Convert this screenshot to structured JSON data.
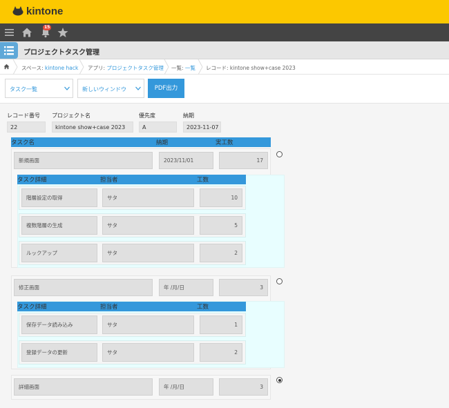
{
  "brand": {
    "name": "kintone"
  },
  "globalbar": {
    "notification_count": "15"
  },
  "app": {
    "title": "プロジェクトタスク管理"
  },
  "breadcrumb": {
    "space_prefix": "スペース: ",
    "space_name": "kintone hack",
    "app_prefix": "アプリ: ",
    "app_name": "プロジェクトタスク管理",
    "list_prefix": "一覧: ",
    "list_name": "一覧",
    "record": "レコード: kintone show+case 2023"
  },
  "toolbar": {
    "view_select": "タスク一覧",
    "window_select": "新しいウィンドウ",
    "pdf_button": "PDF出力"
  },
  "fields": {
    "record_no": {
      "label": "レコード番号",
      "value": "22"
    },
    "project_name": {
      "label": "プロジェクト名",
      "value": "kintone show+case 2023"
    },
    "priority": {
      "label": "優先度",
      "value": "A"
    },
    "deadline": {
      "label": "納期",
      "value": "2023-11-07"
    }
  },
  "task_table": {
    "headers": {
      "name": "タスク名",
      "deadline": "納期",
      "hours": "実工数"
    },
    "rows": [
      {
        "name": "新規画面",
        "deadline": "2023/11/01",
        "hours": "17",
        "detail_headers": {
          "detail": "タスク詳細",
          "assignee": "担当者",
          "hours": "工数"
        },
        "details": [
          {
            "detail": "階層設定の取得",
            "assignee": "サタ",
            "hours": "10"
          },
          {
            "detail": "複数階層の生成",
            "assignee": "サタ",
            "hours": "5"
          },
          {
            "detail": "ルックアップ",
            "assignee": "サタ",
            "hours": "2"
          }
        ]
      },
      {
        "name": "修正画面",
        "deadline": "年 /月/日",
        "hours": "3",
        "detail_headers": {
          "detail": "タスク詳細",
          "assignee": "担当者",
          "hours": "工数"
        },
        "details": [
          {
            "detail": "保存データ読み込み",
            "assignee": "サタ",
            "hours": "1"
          },
          {
            "detail": "登録データの更新",
            "assignee": "サタ",
            "hours": "2"
          }
        ]
      },
      {
        "name": "詳細画面",
        "deadline": "年 /月/日",
        "hours": "3"
      }
    ]
  },
  "colors": {
    "brand_yellow": "#fcc800",
    "accent_blue": "#3498db",
    "subtable_bg": "#e8feff"
  }
}
